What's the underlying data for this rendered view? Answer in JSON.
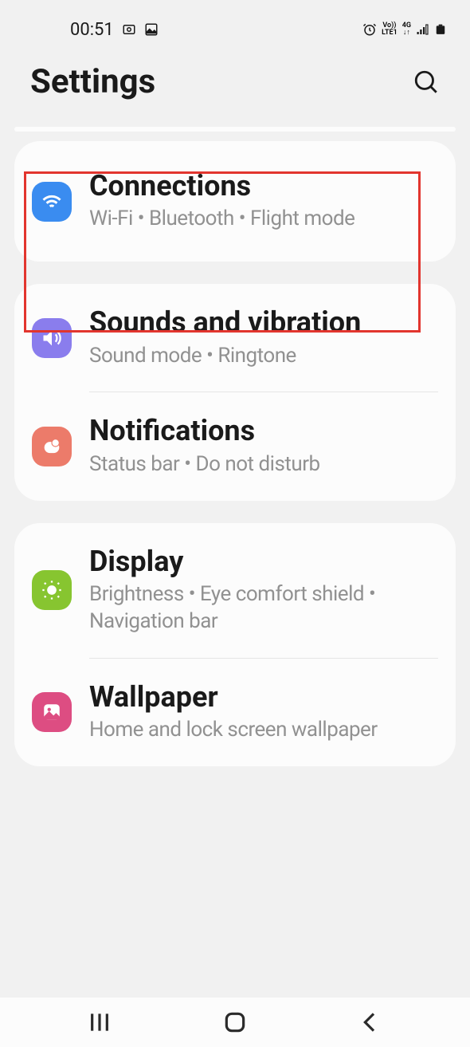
{
  "status": {
    "time": "00:51",
    "volte": "Vo))",
    "lte": "LTE1",
    "network": "4G"
  },
  "header": {
    "title": "Settings"
  },
  "sections": [
    {
      "items": [
        {
          "title": "Connections",
          "subtitle": "Wi-Fi  •  Bluetooth  •  Flight mode"
        }
      ]
    },
    {
      "items": [
        {
          "title": "Sounds and vibration",
          "subtitle": "Sound mode  •  Ringtone"
        },
        {
          "title": "Notifications",
          "subtitle": "Status bar  •  Do not disturb"
        }
      ]
    },
    {
      "items": [
        {
          "title": "Display",
          "subtitle": "Brightness  •  Eye comfort shield  •  Navigation bar"
        },
        {
          "title": "Wallpaper",
          "subtitle": "Home and lock screen wallpaper"
        }
      ]
    }
  ]
}
